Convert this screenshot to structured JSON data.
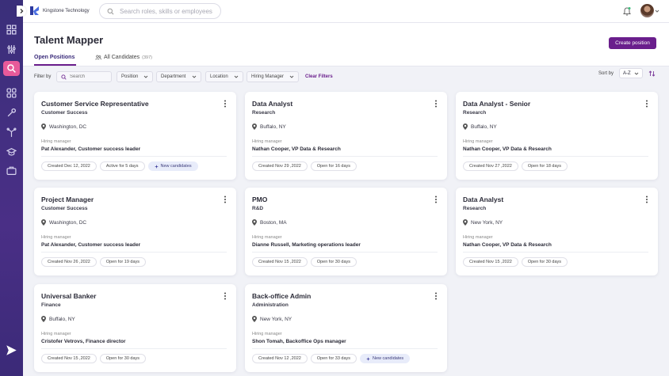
{
  "app": {
    "logo_text": "Kingstone Technology",
    "search_placeholder": "Search roles, skills or employees"
  },
  "sidebar": {
    "icons": [
      "dashboard-icon",
      "sliders-icon",
      "talent-search-icon",
      "apps-grid-icon",
      "tools-icon",
      "career-path-icon",
      "graduation-cap-icon",
      "briefcase-icon",
      "send-icon"
    ],
    "active_color": "#e85a9a"
  },
  "header": {
    "title": "Talent Mapper",
    "create_button": "Create position",
    "tabs": [
      {
        "label": "Open Positions",
        "count": ""
      },
      {
        "label": "All Candidates",
        "count": "(397)"
      }
    ]
  },
  "filters": {
    "label": "Filter by",
    "search_placeholder": "Search",
    "dropdowns": [
      "Position",
      "Department",
      "Location",
      "Hiring Manager"
    ],
    "clear_label": "Clear Filters",
    "sort_label": "Sort by",
    "sort_value": "A-Z"
  },
  "cards": [
    {
      "title": "Customer Service Representative",
      "department": "Customer Success",
      "location": "Washington, DC",
      "hm_label": "Hiring manager",
      "hm_name": "Pat Alexander, Customer success leader",
      "created": "Created Dec 12, 2022",
      "status": "Active for 5 days",
      "new_candidates": "New candidates"
    },
    {
      "title": "Data Analyst",
      "department": "Research",
      "location": "Buffalo, NY",
      "hm_label": "Hiring manager",
      "hm_name": "Nathan Cooper, VP Data & Research",
      "created": "Created Nov 29 ,2022",
      "status": "Open for 16 days",
      "new_candidates": ""
    },
    {
      "title": "Data Analyst - Senior",
      "department": "Research",
      "location": "Buffalo, NY",
      "hm_label": "Hiring manager",
      "hm_name": "Nathan Cooper, VP Data & Research",
      "created": "Created Nov 27 ,2022",
      "status": "Open for 18 days",
      "new_candidates": ""
    },
    {
      "title": "Project Manager",
      "department": "Customer Success",
      "location": "Washington, DC",
      "hm_label": "Hiring manager",
      "hm_name": "Pat Alexander, Customer success leader",
      "created": "Created Nov 26 ,2022",
      "status": "Open for 19 days",
      "new_candidates": ""
    },
    {
      "title": "PMO",
      "department": "R&D",
      "location": "Boston, MA",
      "hm_label": "Hiring manager",
      "hm_name": "Dianne Russell, Marketing operations leader",
      "created": "Created Nov 15 ,2022",
      "status": "Open for 30 days",
      "new_candidates": ""
    },
    {
      "title": "Data Analyst",
      "department": "Research",
      "location": "New York, NY",
      "hm_label": "Hiring manager",
      "hm_name": "Nathan Cooper, VP Data & Research",
      "created": "Created Nov 15 ,2022",
      "status": "Open for 30 days",
      "new_candidates": ""
    },
    {
      "title": "Universal Banker",
      "department": "Finance",
      "location": "Buffalo, NY",
      "hm_label": "Hiring manager",
      "hm_name": "Cristofer Vetrovs, Finance director",
      "created": "Created Nov 15 ,2022",
      "status": "Open for 30 days",
      "new_candidates": ""
    },
    {
      "title": "Back-office Admin",
      "department": "Administration",
      "location": "New York, NY",
      "hm_label": "Hiring manager",
      "hm_name": "Shon Tomah, Backoffice Ops manager",
      "created": "Created Nov 12 ,2022",
      "status": "Open for 33 days",
      "new_candidates": "New candidates"
    }
  ]
}
